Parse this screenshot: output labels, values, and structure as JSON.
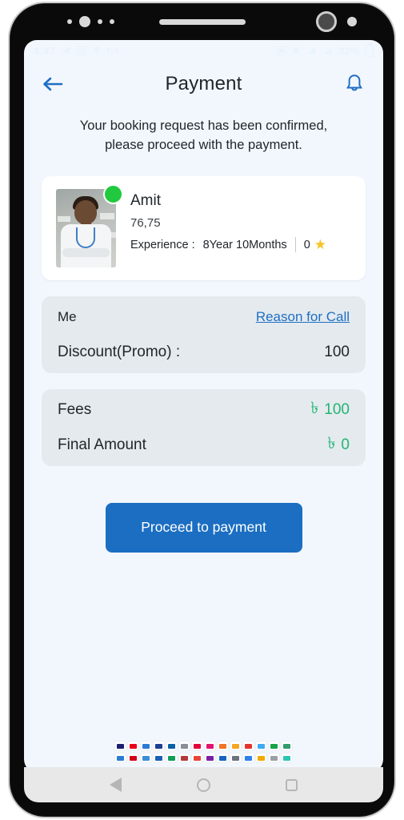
{
  "status_bar": {
    "time": "4:47",
    "left_icons": [
      "telegram-icon",
      "instagram-icon",
      "bell-icon",
      "gmail-icon"
    ],
    "right_icons": [
      "sim-icon",
      "vibrate-icon",
      "network-4g-icon",
      "signal-icon"
    ],
    "battery_percent": "32%"
  },
  "appbar": {
    "back_icon": "back-arrow-icon",
    "title": "Payment",
    "notification_icon": "bell-icon"
  },
  "intro": {
    "line1": "Your booking request has been confirmed,",
    "line2": "please proceed with the payment."
  },
  "doctor": {
    "name": "Amit",
    "subtitle": "76,75",
    "experience_label": "Experience :",
    "experience_value": "8Year 10Months",
    "rating": "0",
    "star_icon": "star-icon",
    "status": "online",
    "status_color": "#21c93f"
  },
  "summary": {
    "owner_label": "Me",
    "reason_link": "Reason for Call",
    "discount_label": "Discount(Promo) :",
    "discount_value": "100"
  },
  "fees": {
    "fees_label": "Fees",
    "fees_currency": "৳",
    "fees_value": "100",
    "final_label": "Final Amount",
    "final_currency": "৳",
    "final_value": "0",
    "amount_color": "#22b573"
  },
  "cta": {
    "label": "Proceed to payment",
    "color": "#1b6ec2"
  },
  "payment_methods": {
    "row1": [
      {
        "name": "visa",
        "color": "#1a1f71"
      },
      {
        "name": "mastercard",
        "color": "#eb001b"
      },
      {
        "name": "card-blue",
        "color": "#2b7cd3"
      },
      {
        "name": "amex",
        "color": "#1c3f94"
      },
      {
        "name": "dbbl",
        "color": "#0b5fa5"
      },
      {
        "name": "bank-card",
        "color": "#8a8f98"
      },
      {
        "name": "rocket",
        "color": "#e4003a"
      },
      {
        "name": "bkash",
        "color": "#e2136e"
      },
      {
        "name": "nagad",
        "color": "#ee7623"
      },
      {
        "name": "upay",
        "color": "#f5a623"
      },
      {
        "name": "okwallet",
        "color": "#e3342f"
      },
      {
        "name": "tap",
        "color": "#3fa9f5"
      },
      {
        "name": "mcash",
        "color": "#16a34a"
      },
      {
        "name": "mycash",
        "color": "#2e9e6b"
      }
    ],
    "row2": [
      {
        "name": "cellfin",
        "color": "#2b7cd3"
      },
      {
        "name": "redcard",
        "color": "#d0021b"
      },
      {
        "name": "bluecard",
        "color": "#3a8fd4"
      },
      {
        "name": "qcash",
        "color": "#1a5fb4"
      },
      {
        "name": "islami",
        "color": "#0f9d58"
      },
      {
        "name": "bank",
        "color": "#b33a3a"
      },
      {
        "name": "aamarpay",
        "color": "#e8453c"
      },
      {
        "name": "surecash",
        "color": "#7b1fa2"
      },
      {
        "name": "dmoney",
        "color": "#1565c0"
      },
      {
        "name": "city",
        "color": "#6b7280"
      },
      {
        "name": "ebl",
        "color": "#2f80ed"
      },
      {
        "name": "gold",
        "color": "#f2a900"
      },
      {
        "name": "ipay",
        "color": "#9aa0a6"
      },
      {
        "name": "tapgreen",
        "color": "#2ec4b6"
      }
    ]
  },
  "navbar": {
    "back": "nav-back-icon",
    "home": "nav-home-icon",
    "recents": "nav-recents-icon"
  }
}
